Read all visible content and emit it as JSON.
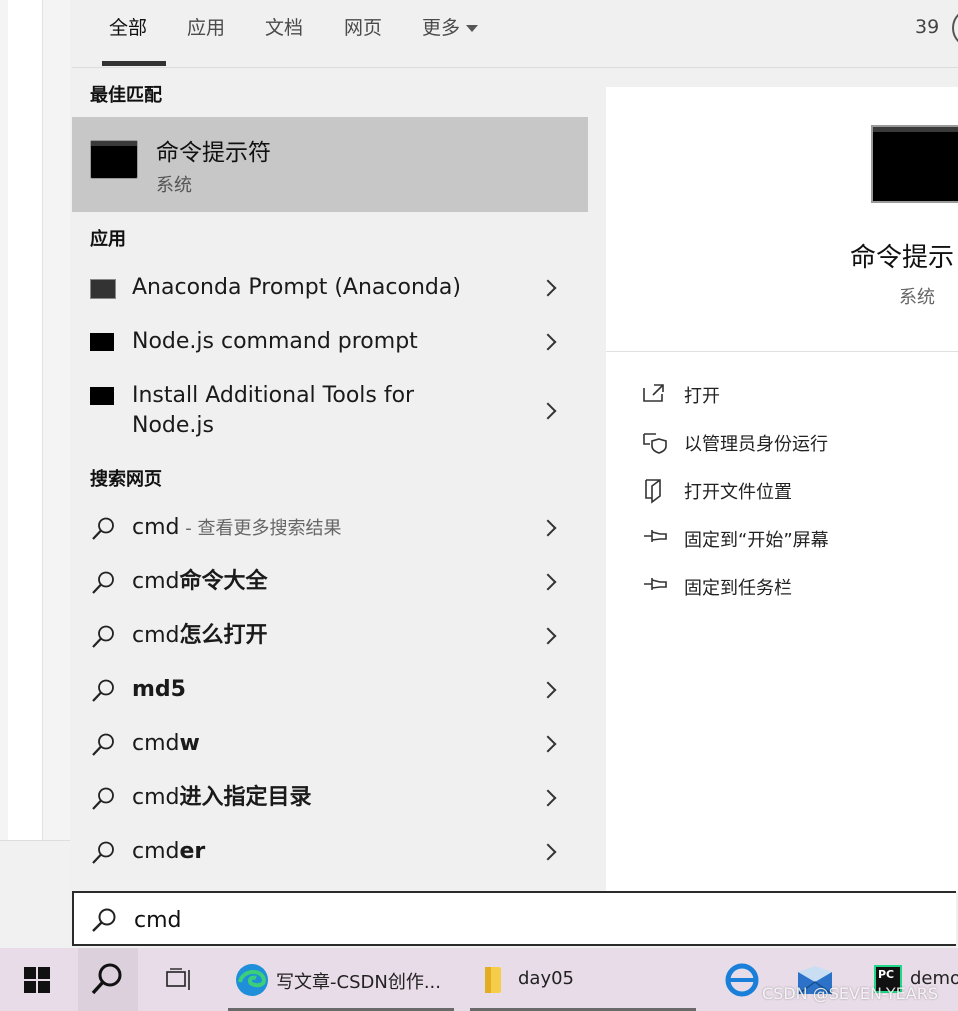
{
  "tabs": {
    "items": [
      {
        "label": "全部"
      },
      {
        "label": "应用"
      },
      {
        "label": "文档"
      },
      {
        "label": "网页"
      },
      {
        "label": "更多"
      }
    ],
    "count": "39"
  },
  "sections": {
    "best_match": "最佳匹配",
    "apps": "应用",
    "web": "搜索网页"
  },
  "best_match": {
    "title": "命令提示符",
    "subtitle": "系统"
  },
  "apps": [
    {
      "label": "Anaconda Prompt (Anaconda)"
    },
    {
      "label": "Node.js command prompt"
    },
    {
      "label_line1": "Install Additional Tools for",
      "label_line2": "Node.js"
    }
  ],
  "web_results": [
    {
      "prefix": "cmd",
      "suffix": " - 查看更多搜索结果"
    },
    {
      "prefix": "cmd",
      "bold": "命令大全"
    },
    {
      "prefix": "cmd",
      "bold": "怎么打开"
    },
    {
      "prefix": "",
      "bold": "md5"
    },
    {
      "prefix": "cmd",
      "bold": "w"
    },
    {
      "prefix": "cmd",
      "bold": "进入指定目录"
    },
    {
      "prefix": "cmd",
      "bold": "er"
    }
  ],
  "preview": {
    "title": "命令提示",
    "subtitle": "系统",
    "actions": [
      {
        "label": "打开",
        "icon": "open-icon"
      },
      {
        "label": "以管理员身份运行",
        "icon": "shield-icon"
      },
      {
        "label": "打开文件位置",
        "icon": "file-location-icon"
      },
      {
        "label": "固定到“开始”屏幕",
        "icon": "pin-icon"
      },
      {
        "label": "固定到任务栏",
        "icon": "pin-icon"
      }
    ]
  },
  "search": {
    "value": "cmd"
  },
  "taskbar": {
    "items": [
      {
        "label": "写文章-CSDN创作..."
      },
      {
        "label": "day05"
      },
      {
        "label": "demo"
      }
    ],
    "pycharm_badge": "PC"
  },
  "watermark": "CSDN @SEVEN-YEARS"
}
